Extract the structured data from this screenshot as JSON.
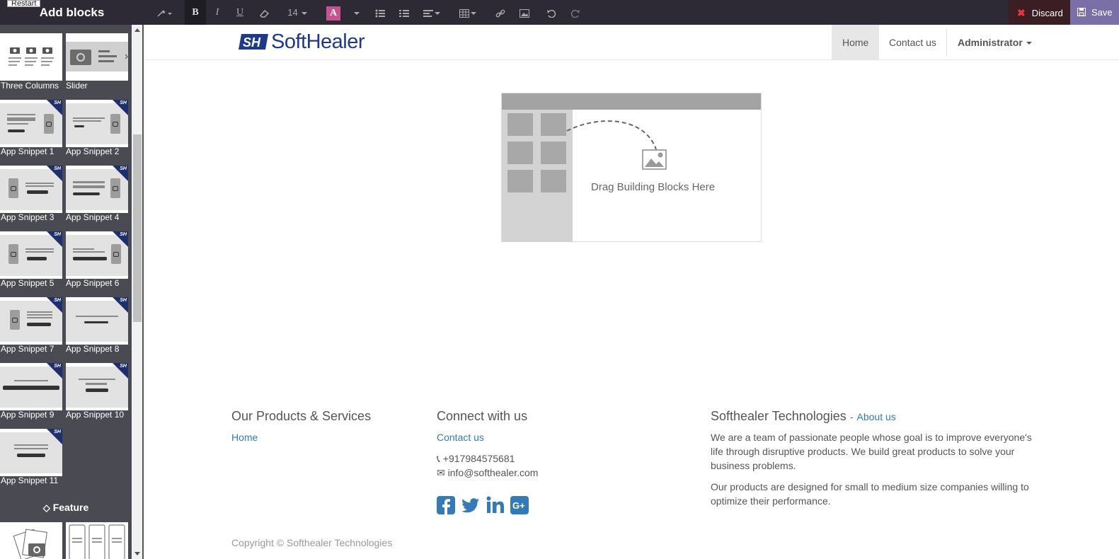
{
  "tooltip": {
    "restart": "Restart"
  },
  "sidebar": {
    "title": "Add blocks",
    "snippets": [
      {
        "label": "Three Columns"
      },
      {
        "label": "Slider"
      },
      {
        "label": "App Snippet 1"
      },
      {
        "label": "App Snippet 2"
      },
      {
        "label": "App Snippet 3"
      },
      {
        "label": "App Snippet 4"
      },
      {
        "label": "App Snippet 5"
      },
      {
        "label": "App Snippet 6"
      },
      {
        "label": "App Snippet 7"
      },
      {
        "label": "App Snippet 8"
      },
      {
        "label": "App Snippet 9"
      },
      {
        "label": "App Snippet 10"
      },
      {
        "label": "App Snippet 11"
      }
    ],
    "feature_heading": "Feature",
    "ribbon_text": "SH"
  },
  "toolbar": {
    "font_size": "14",
    "bold": "B",
    "italic": "I",
    "underline": "U",
    "color_letter": "A",
    "discard_label": "Discard",
    "save_label": "Save",
    "accent_color": "#7a6fa7",
    "discard_color": "#e4363f"
  },
  "header": {
    "logo_text": "SoftHealer",
    "nav": {
      "home": "Home",
      "contact": "Contact us",
      "admin": "Administrator"
    }
  },
  "dropzone": {
    "text": "Drag Building Blocks Here"
  },
  "footer": {
    "col1": {
      "heading": "Our Products & Services",
      "link": "Home"
    },
    "col2": {
      "heading": "Connect with us",
      "link": "Contact us",
      "phone": "+917984575681",
      "email": "info@softhealer.com"
    },
    "col3": {
      "heading": "Softhealer Technologies",
      "about_prefix": "-",
      "about_link": "About us",
      "para1": "We are a team of passionate people whose goal is to improve everyone's life through disruptive products. We build great products to solve your business problems.",
      "para2": "Our products are designed for small to medium size companies willing to optimize their performance."
    },
    "copyright": "Copyright © Softhealer Technologies",
    "social_icons": [
      "facebook-icon",
      "twitter-icon",
      "linkedin-icon",
      "google-plus-icon"
    ],
    "social_color": "#337ab7"
  }
}
